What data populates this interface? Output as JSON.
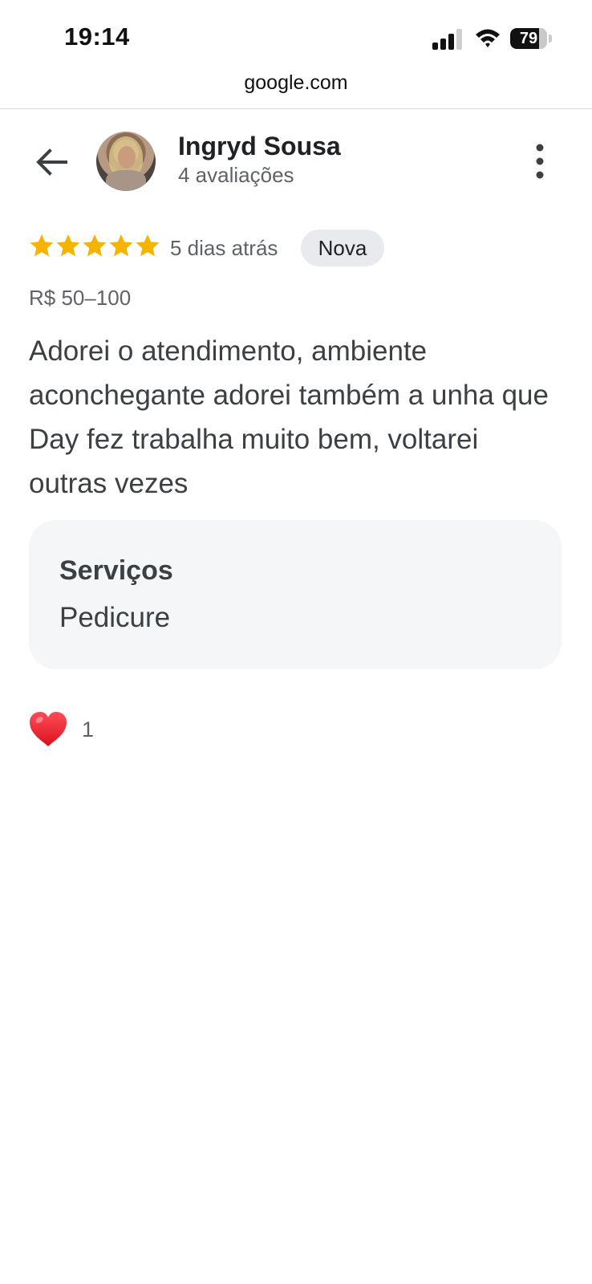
{
  "status_bar": {
    "time": "19:14",
    "battery_level": "79",
    "battery_fraction": 0.79,
    "signal_bars": 3,
    "wifi_icon": "wifi-icon"
  },
  "browser": {
    "url": "google.com"
  },
  "reviewer": {
    "name": "Ingryd Sousa",
    "meta": "4 avaliações",
    "avatar_icon": "avatar"
  },
  "review": {
    "rating": 5,
    "max_rating": 5,
    "date": "5 dias atrás",
    "badge": "Nova",
    "price_range": "R$ 50–100",
    "text": "Adorei o atendimento, ambiente aconchegante adorei também a unha que Day fez trabalha muito bem, voltarei outras vezes",
    "services": {
      "title": "Serviços",
      "value": "Pedicure"
    },
    "reactions": {
      "icon": "heart-icon",
      "count": "1"
    }
  },
  "colors": {
    "star": "#f4b400",
    "heart": "#e0192a",
    "badge_bg": "#e8eaed",
    "card_bg": "#f5f6f7",
    "text_primary": "#202124",
    "text_secondary": "#5f6368"
  },
  "icons": {
    "back": "back-arrow-icon",
    "more": "more-vert-icon",
    "star": "star-icon"
  }
}
